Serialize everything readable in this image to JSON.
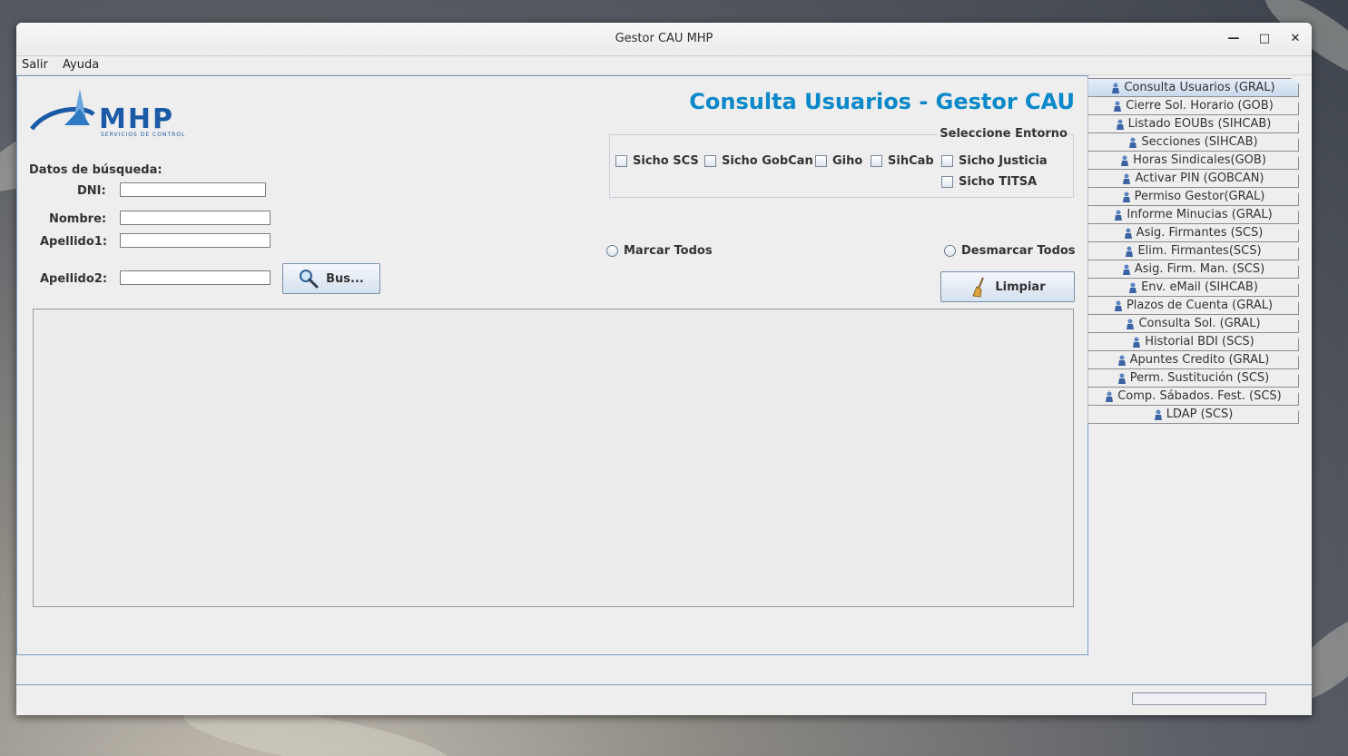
{
  "window": {
    "title": "Gestor CAU MHP"
  },
  "menu": [
    "Salir",
    "Ayuda"
  ],
  "header": {
    "title": "Consulta Usuarios - Gestor CAU",
    "title_color": "#0a88c9"
  },
  "logo": {
    "text": "MHP",
    "subtitle": "SERVICIOS DE CONTROL",
    "color": "#1b5aa6"
  },
  "search": {
    "section_label": "Datos de búsqueda:",
    "fields": [
      {
        "label": "DNI:",
        "value": ""
      },
      {
        "label": "Nombre:",
        "value": ""
      },
      {
        "label": "Apellido1:",
        "value": ""
      },
      {
        "label": "Apellido2:",
        "value": ""
      }
    ],
    "search_button": "Bus..."
  },
  "entorno": {
    "legend": "Seleccione Entorno",
    "options": [
      "Sicho SCS",
      "Sicho GobCan",
      "Giho",
      "SihCab",
      "Sicho Justicia",
      "Sicho TITSA"
    ]
  },
  "select_all": "Marcar Todos",
  "deselect_all": "Desmarcar Todos",
  "clear_button": "Limpiar",
  "tabs": [
    "Consulta Usuarios (GRAL)",
    "Cierre Sol. Horario (GOB)",
    "Listado EOUBs (SIHCAB)",
    "Secciones (SIHCAB)",
    "Horas Sindicales(GOB)",
    "Activar PIN (GOBCAN)",
    "Permiso Gestor(GRAL)",
    "Informe Minucias (GRAL)",
    "Asig. Firmantes (SCS)",
    "Elim. Firmantes(SCS)",
    "Asig. Firm. Man. (SCS)",
    "Env. eMail (SIHCAB)",
    "Plazos de Cuenta (GRAL)",
    "Consulta Sol. (GRAL)",
    "Historial BDI (SCS)",
    "Apuntes Credito (GRAL)",
    "Perm. Sustitución (SCS)",
    "Comp. Sábados. Fest. (SCS)",
    "LDAP (SCS)"
  ]
}
